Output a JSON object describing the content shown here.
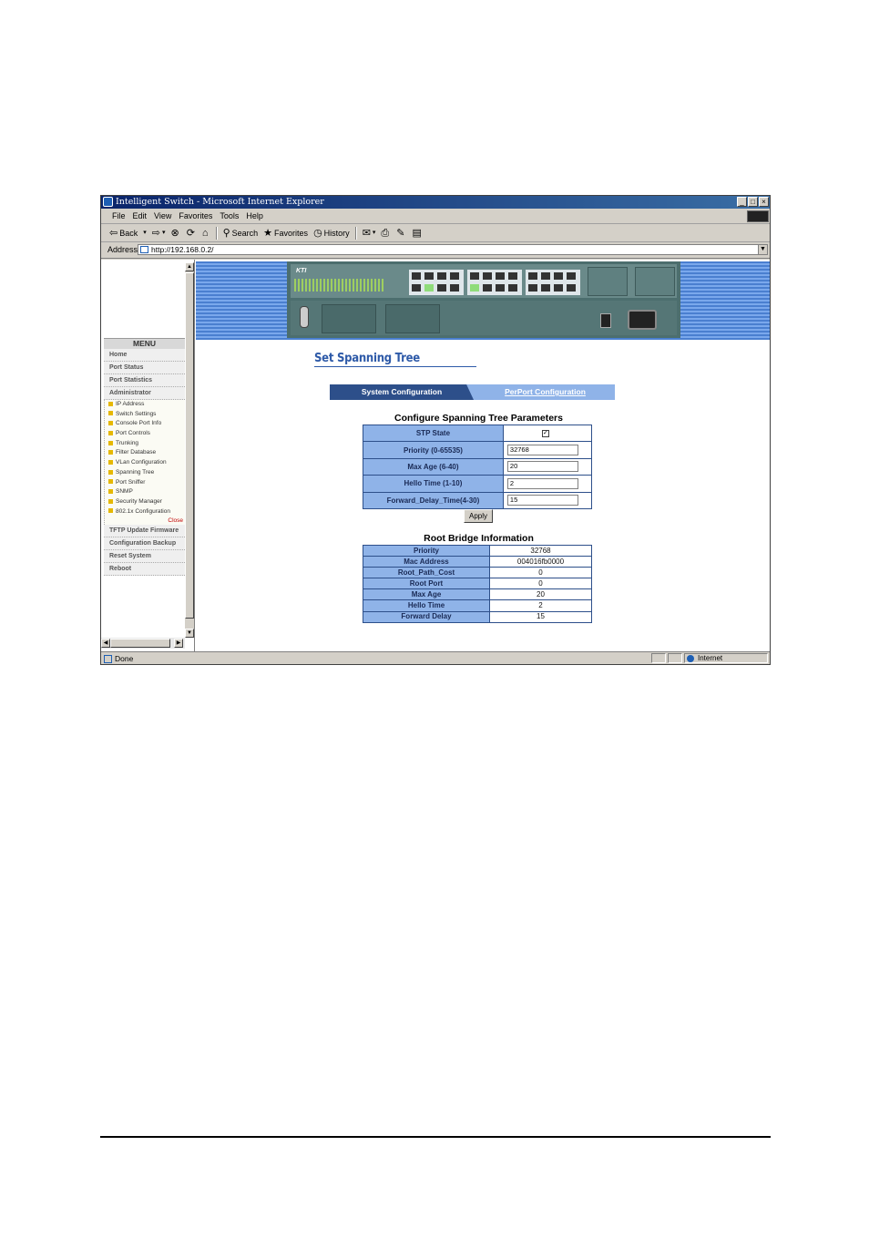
{
  "window": {
    "title": "Intelligent Switch - Microsoft Internet Explorer",
    "controls": [
      "_",
      "□",
      "×"
    ]
  },
  "menubar": [
    "File",
    "Edit",
    "View",
    "Favorites",
    "Tools",
    "Help"
  ],
  "toolbar": {
    "back": "Back",
    "search": "Search",
    "favorites": "Favorites",
    "history": "History"
  },
  "address": {
    "label": "Address",
    "url": "http://192.168.0.2/"
  },
  "sidebar": {
    "menu_title": "MENU",
    "items_top": [
      "Home",
      "Port Status",
      "Port Statistics",
      "Administrator"
    ],
    "sub_items": [
      "IP Address",
      "Switch Settings",
      "Console Port Info",
      "Port Controls",
      "Trunking",
      "Filter Database",
      "VLan Configuration",
      "Spanning Tree",
      "Port Sniffer",
      "SNMP",
      "Security Manager",
      "802.1x Configuration"
    ],
    "close": "Close",
    "items_bottom": [
      "TFTP Update Firmware",
      "Configuration Backup",
      "Reset System",
      "Reboot"
    ]
  },
  "banner": {
    "logo": "KTI"
  },
  "page": {
    "title": "Set Spanning Tree",
    "tabs": {
      "active": "System Configuration",
      "inactive": "PerPort Configuration"
    },
    "config": {
      "title": "Configure Spanning Tree Parameters",
      "stp_state_label": "STP State",
      "stp_state_checked": "✓",
      "priority_label": "Priority (0-65535)",
      "priority_value": "32768",
      "max_age_label": "Max Age (6-40)",
      "max_age_value": "20",
      "hello_time_label": "Hello Time (1-10)",
      "hello_time_value": "2",
      "forward_delay_label": "Forward_Delay_Time(4-30)",
      "forward_delay_value": "15",
      "apply": "Apply"
    },
    "root_bridge": {
      "title": "Root Bridge Information",
      "rows": [
        {
          "label": "Priority",
          "value": "32768"
        },
        {
          "label": "Mac Address",
          "value": "004016fb0000"
        },
        {
          "label": "Root_Path_Cost",
          "value": "0"
        },
        {
          "label": "Root Port",
          "value": "0"
        },
        {
          "label": "Max Age",
          "value": "20"
        },
        {
          "label": "Hello Time",
          "value": "2"
        },
        {
          "label": "Forward Delay",
          "value": "15"
        }
      ]
    }
  },
  "status": {
    "left": "Done",
    "zone": "Internet"
  }
}
